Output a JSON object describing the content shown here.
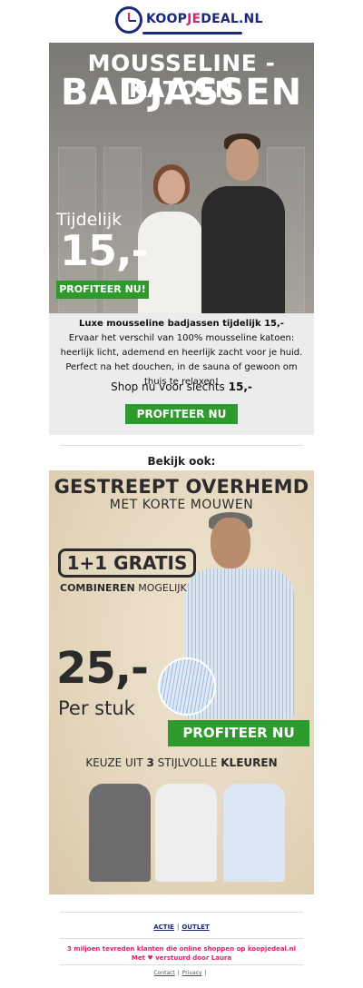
{
  "header": {
    "logo_text_1": "KOOP",
    "logo_text_2": "JE",
    "logo_text_3": "DEAL.NL"
  },
  "hero1": {
    "title_line1": "MOUSSELINE - KATOEN",
    "title_line2": "BADJASSEN",
    "tijdelijk": "Tijdelijk",
    "price": "15,-",
    "cta": "PROFITEER NU!"
  },
  "product_box": {
    "title": "Luxe mousseline badjassen tijdelijk 15,-",
    "body": "Ervaar het verschil van 100% mousseline katoen: heerlijk licht, ademend en heerlijk zacht voor je huid. Perfect na het douchen, in de sauna of gewoon om thuis te relaxen!",
    "shop_prefix": "Shop nu voor slechts",
    "shop_price": "15,-",
    "cta": "PROFITEER NU"
  },
  "bekijk_ook": "Bekijk ook:",
  "hero2": {
    "title": "GESTREEPT OVERHEMD",
    "subtitle": "MET KORTE MOUWEN",
    "deal": "1+1 GRATIS",
    "combineren_bold": "COMBINEREN",
    "combineren_rest": " MOGELIJK",
    "price": "25,-",
    "per_stuk": "Per stuk",
    "cta": "PROFITEER NU",
    "keuze_1": "KEUZE UIT ",
    "keuze_2": "3",
    "keuze_3": " STIJLVOLLE ",
    "keuze_4": "KLEUREN"
  },
  "footer": {
    "link_actie": "ACTIE",
    "link_outlet": "OUTLET",
    "separator": "|",
    "line1": "3 miljoen tevreden klanten die online shoppen op koopjedeal.nl",
    "line2": "Met ♥ verstuurd door Laura",
    "legal_contact": "Contact",
    "legal_privacy": "Privacy"
  },
  "colors": {
    "brand_navy": "#1d2a7a",
    "brand_pink": "#d6246e",
    "cta_green": "#2e9a2e",
    "box_gray": "#ececec"
  }
}
